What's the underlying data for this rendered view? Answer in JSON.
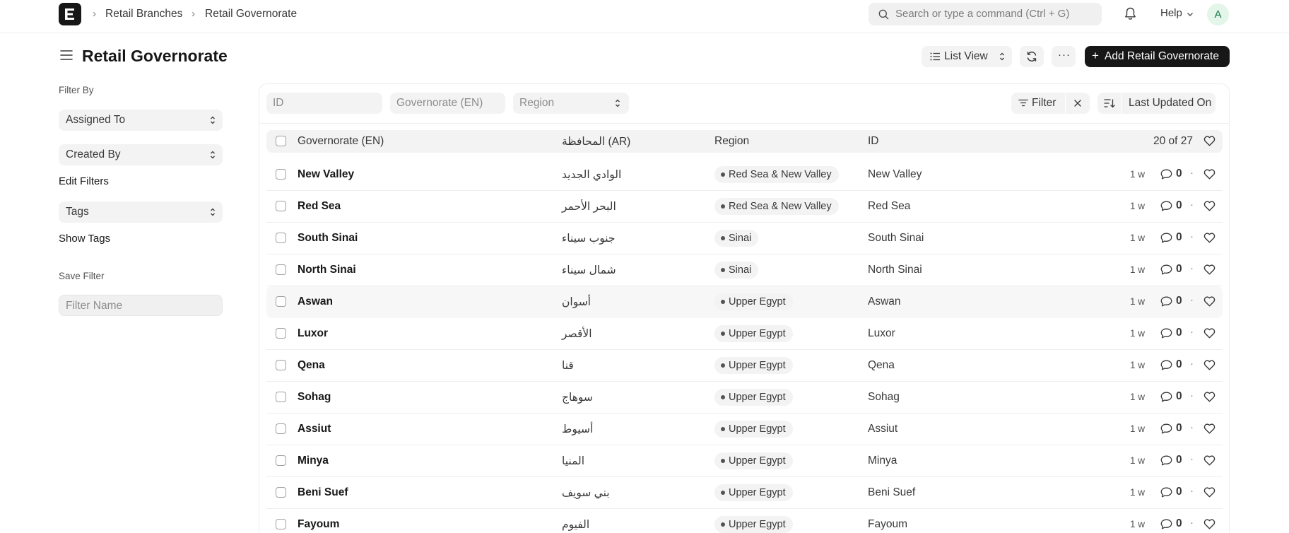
{
  "navbar": {
    "breadcrumbs": [
      "Retail Branches",
      "Retail Governorate"
    ],
    "search_placeholder": "Search or type a command (Ctrl + G)",
    "help_label": "Help",
    "avatar_initial": "A"
  },
  "page": {
    "title": "Retail Governorate",
    "list_view_label": "List View",
    "more_label": "···",
    "add_label": "Add Retail Governorate"
  },
  "sidebar": {
    "filter_by_label": "Filter By",
    "assigned_to": "Assigned To",
    "created_by": "Created By",
    "edit_filters": "Edit Filters",
    "tags": "Tags",
    "show_tags": "Show Tags",
    "save_filter_label": "Save Filter",
    "filter_name_placeholder": "Filter Name"
  },
  "filters": {
    "id_placeholder": "ID",
    "governorate_placeholder": "Governorate (EN)",
    "region_placeholder": "Region",
    "filter_label": "Filter",
    "sort_label": "Last Updated On"
  },
  "table": {
    "columns": [
      "Governorate (EN)",
      "المحافظة (AR)",
      "Region",
      "ID"
    ],
    "count": "20 of 27",
    "rows": [
      {
        "name": "New Valley",
        "ar": "الوادي الجديد",
        "region": "Red Sea & New Valley",
        "id": "New Valley",
        "time": "1 w",
        "comments": "0"
      },
      {
        "name": "Red Sea",
        "ar": "البحر الأحمر",
        "region": "Red Sea & New Valley",
        "id": "Red Sea",
        "time": "1 w",
        "comments": "0"
      },
      {
        "name": "South Sinai",
        "ar": "جنوب سيناء",
        "region": "Sinai",
        "id": "South Sinai",
        "time": "1 w",
        "comments": "0"
      },
      {
        "name": "North Sinai",
        "ar": "شمال سيناء",
        "region": "Sinai",
        "id": "North Sinai",
        "time": "1 w",
        "comments": "0"
      },
      {
        "name": "Aswan",
        "ar": "أسوان",
        "region": "Upper Egypt",
        "id": "Aswan",
        "time": "1 w",
        "comments": "0"
      },
      {
        "name": "Luxor",
        "ar": "الأقصر",
        "region": "Upper Egypt",
        "id": "Luxor",
        "time": "1 w",
        "comments": "0"
      },
      {
        "name": "Qena",
        "ar": "قنا",
        "region": "Upper Egypt",
        "id": "Qena",
        "time": "1 w",
        "comments": "0"
      },
      {
        "name": "Sohag",
        "ar": "سوهاج",
        "region": "Upper Egypt",
        "id": "Sohag",
        "time": "1 w",
        "comments": "0"
      },
      {
        "name": "Assiut",
        "ar": "أسيوط",
        "region": "Upper Egypt",
        "id": "Assiut",
        "time": "1 w",
        "comments": "0"
      },
      {
        "name": "Minya",
        "ar": "المنيا",
        "region": "Upper Egypt",
        "id": "Minya",
        "time": "1 w",
        "comments": "0"
      },
      {
        "name": "Beni Suef",
        "ar": "بني سويف",
        "region": "Upper Egypt",
        "id": "Beni Suef",
        "time": "1 w",
        "comments": "0"
      },
      {
        "name": "Fayoum",
        "ar": "الفيوم",
        "region": "Upper Egypt",
        "id": "Fayoum",
        "time": "1 w",
        "comments": "0"
      }
    ]
  }
}
